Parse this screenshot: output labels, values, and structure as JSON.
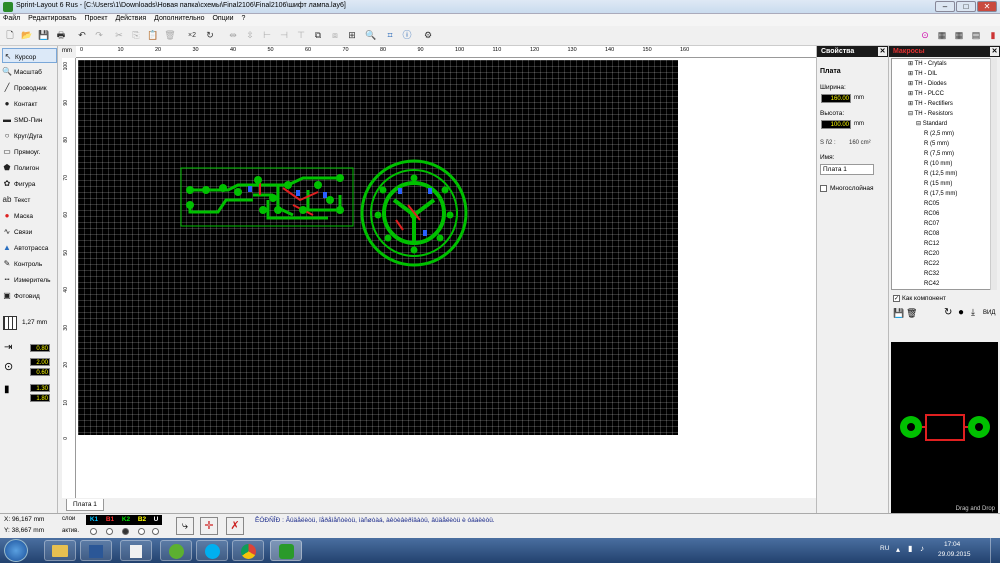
{
  "window": {
    "title": "Sprint-Layout 6 Rus - [C:\\Users\\1\\Downloads\\Новая папка\\схемы\\Final2106\\Final2106\\шифт лампа.lay6]",
    "min": "–",
    "max": "□",
    "close": "✕"
  },
  "menu": [
    "Файл",
    "Редактировать",
    "Проект",
    "Действия",
    "Дополнительно",
    "Опции",
    "?"
  ],
  "toolbar": {
    "zoom_label": "×2"
  },
  "tools": [
    {
      "label": "Курсор",
      "icon": "cursor-icon",
      "glyph": "↖"
    },
    {
      "label": "Масштаб",
      "icon": "zoom-icon",
      "glyph": "🔍"
    },
    {
      "label": "Проводник",
      "icon": "track-icon",
      "glyph": "╱"
    },
    {
      "label": "Контакт",
      "icon": "pad-icon",
      "glyph": "●"
    },
    {
      "label": "SMD-Пин",
      "icon": "smd-icon",
      "glyph": "▬"
    },
    {
      "label": "Круг/Дуга",
      "icon": "circle-icon",
      "glyph": "○"
    },
    {
      "label": "Прямоуг.",
      "icon": "rect-icon",
      "glyph": "▭"
    },
    {
      "label": "Полигон",
      "icon": "polygon-icon",
      "glyph": "⬟"
    },
    {
      "label": "Фигура",
      "icon": "shape-icon",
      "glyph": "✿"
    },
    {
      "label": "Текст",
      "icon": "text-icon",
      "glyph": "ab"
    },
    {
      "label": "Маска",
      "icon": "mask-icon",
      "glyph": "●"
    },
    {
      "label": "Связи",
      "icon": "connection-icon",
      "glyph": "∿"
    },
    {
      "label": "Автотрасса",
      "icon": "autoroute-icon",
      "glyph": "▲"
    },
    {
      "label": "Контроль",
      "icon": "test-icon",
      "glyph": "✎"
    },
    {
      "label": "Измеритель",
      "icon": "measure-icon",
      "glyph": "┅"
    },
    {
      "label": "Фотовид",
      "icon": "photo-icon",
      "glyph": "▣"
    }
  ],
  "grid": {
    "value": "1,27 mm"
  },
  "track_width": "0.80",
  "pad_outer": "2.00",
  "pad_inner": "0.60",
  "smd_w": "1.30",
  "smd_h": "1.80",
  "ruler_top_unit": "mm",
  "ruler_top_ticks": [
    "0",
    "10",
    "20",
    "30",
    "40",
    "50",
    "60",
    "70",
    "80",
    "90",
    "100",
    "110",
    "120",
    "130",
    "140",
    "150",
    "160"
  ],
  "ruler_left_ticks": [
    "100",
    "90",
    "80",
    "70",
    "60",
    "50",
    "40",
    "30",
    "20",
    "10",
    "0"
  ],
  "tab": "Плата 1",
  "props": {
    "header": "Свойства",
    "section": "Плата",
    "width_label": "Ширина:",
    "width": "160.00",
    "width_unit": "mm",
    "height_label": "Высота:",
    "height": "100.00",
    "height_unit": "mm",
    "area_label": "S ñ2 :",
    "area": "160 cm²",
    "name_label": "Имя:",
    "name": "Плата 1",
    "multilayer": "Многослойная"
  },
  "macros": {
    "header": "Макросы",
    "tree": [
      {
        "t": "⊞ TH - Crytals",
        "l": 1
      },
      {
        "t": "⊞ TH - DIL",
        "l": 1
      },
      {
        "t": "⊞ TH - Diodes",
        "l": 1
      },
      {
        "t": "⊞ TH - PLCC",
        "l": 1
      },
      {
        "t": "⊞ TH - Rectifiers",
        "l": 1
      },
      {
        "t": "⊟ TH - Resistors",
        "l": 1
      },
      {
        "t": "⊟ Standard",
        "l": 2
      },
      {
        "t": "R (2,5 mm)",
        "l": 3
      },
      {
        "t": "R (5 mm)",
        "l": 3
      },
      {
        "t": "R (7,5 mm)",
        "l": 3
      },
      {
        "t": "R (10 mm)",
        "l": 3
      },
      {
        "t": "R (12,5 mm)",
        "l": 3
      },
      {
        "t": "R (15 mm)",
        "l": 3
      },
      {
        "t": "R (17,5 mm)",
        "l": 3
      },
      {
        "t": "RC05",
        "l": 3
      },
      {
        "t": "RC06",
        "l": 3
      },
      {
        "t": "RC07",
        "l": 3
      },
      {
        "t": "RC08",
        "l": 3
      },
      {
        "t": "RC12",
        "l": 3
      },
      {
        "t": "RC20",
        "l": 3
      },
      {
        "t": "RC22",
        "l": 3
      },
      {
        "t": "RC32",
        "l": 3
      },
      {
        "t": "RC42",
        "l": 3
      }
    ],
    "as_component": "Как компонент",
    "view": "ВИД",
    "preview_footer": "Drag and Drop"
  },
  "status": {
    "x": "X:   96,167 mm",
    "y": "Y:   38,667 mm",
    "layers_label": "слои",
    "active_label": "актив.",
    "layers": [
      "K1",
      "B1",
      "K2",
      "B2",
      "U"
    ],
    "layer_colors": [
      "#00c0ff",
      "#ff3030",
      "#00e000",
      "#ffff00",
      "#ffffff"
    ],
    "message": "ÊÓÐÑÎÐ : Âûäåëèòü, ïåðåìåñòèòü, ìàñøòàá, àêòèâèðîâàòü, âûäåëèòü è óäàëèòü."
  },
  "taskbar": {
    "lang": "RU",
    "time": "17:04",
    "date": "29.09.2015"
  }
}
